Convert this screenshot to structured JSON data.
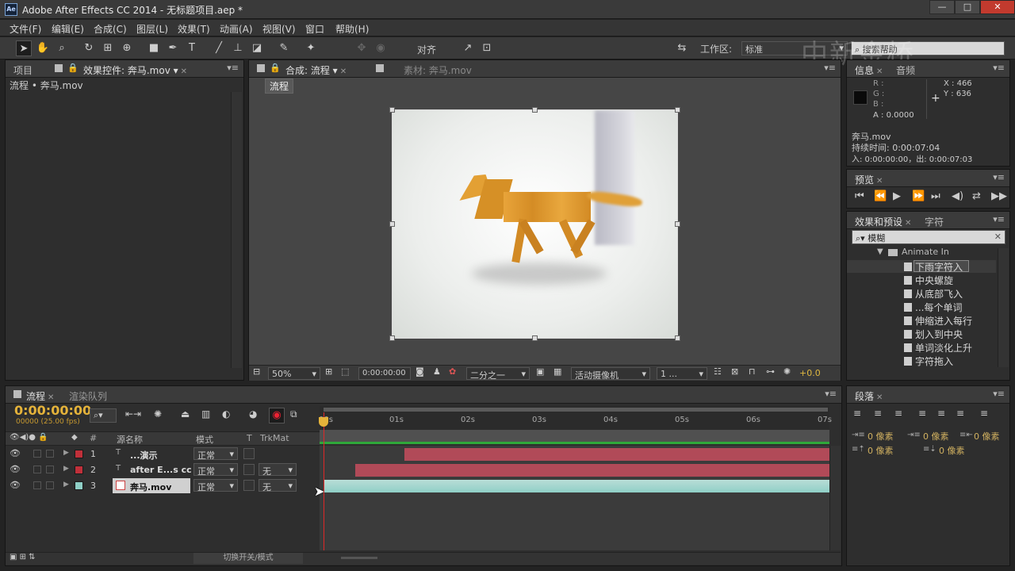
{
  "window": {
    "title": "Adobe After Effects CC 2014 - 无标题项目.aep *",
    "app_icon_label": "Ae",
    "minimize": "—",
    "maximize": "□",
    "close": "✕"
  },
  "menu": [
    "文件(F)",
    "编辑(E)",
    "合成(C)",
    "图层(L)",
    "效果(T)",
    "动画(A)",
    "视图(V)",
    "窗口",
    "帮助(H)"
  ],
  "toolbar": {
    "align_label": "对齐",
    "workspace_label": "工作区:",
    "workspace_value": "标准",
    "search_placeholder": "搜索帮助",
    "watermark": "中新金桥"
  },
  "project_panel": {
    "tab_project": "项目",
    "tab_effect_controls": "效果控件: 奔马.mov",
    "breadcrumb": "流程 • 奔马.mov"
  },
  "composition_panel": {
    "tab_comp": "合成: 流程",
    "tab_footage": "素材: 奔马.mov",
    "flow_tab": "流程",
    "zoom": "50%",
    "timecode": "0:00:00:00",
    "resolution": "二分之一",
    "camera": "活动摄像机",
    "views": "1 ...",
    "exposure": "+0.0"
  },
  "info_panel": {
    "tab_info": "信息",
    "tab_audio": "音频",
    "r": "R :",
    "g": "G :",
    "b": "B :",
    "a": "A : 0.0000",
    "x": "X : 466",
    "y": "Y : 636",
    "file": "奔马.mov",
    "duration": "持续时间: 0:00:07:04",
    "in_out": "入: 0:00:00:00，出: 0:00:07:03"
  },
  "preview_panel": {
    "tab": "预览"
  },
  "effects_panel": {
    "tab_effects": "效果和预设",
    "tab_char": "字符",
    "search_value": "模糊",
    "folder": "Animate In",
    "items": [
      "下雨字符入",
      "中央螺旋",
      "从底部飞入",
      "...每个单词",
      "伸缩进入每行",
      "划入到中央",
      "单词淡化上升",
      "字符拖入"
    ]
  },
  "timeline": {
    "tab_flow": "流程",
    "tab_render": "渲染队列",
    "timecode": "0:00:00:00",
    "frame_info": "00000 (25.00 fps)",
    "col_num": "#",
    "col_source": "源名称",
    "col_mode": "模式",
    "col_t": "T",
    "col_trkmat": "TrkMat",
    "ruler": [
      "00s",
      "01s",
      "02s",
      "03s",
      "04s",
      "05s",
      "06s",
      "07s"
    ],
    "toggle_label": "切换开关/模式",
    "layers": [
      {
        "num": "1",
        "name": "...演示",
        "mode": "正常",
        "trkmat": "",
        "color": "#c0303a"
      },
      {
        "num": "2",
        "name": "after E...s cc",
        "mode": "正常",
        "trkmat": "无",
        "color": "#c0303a"
      },
      {
        "num": "3",
        "name": "奔马.mov",
        "mode": "正常",
        "trkmat": "无",
        "color": "#8fcfc6"
      }
    ]
  },
  "paragraph_panel": {
    "tab": "段落",
    "indent1": "0 像素",
    "indent2": "0 像素",
    "indent3": "0 像素",
    "space1": "0 像素",
    "space2": "0 像素"
  }
}
